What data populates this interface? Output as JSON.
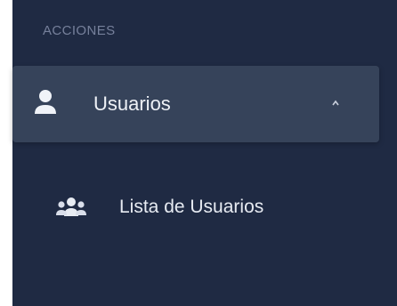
{
  "sidebar": {
    "section_title": "ACCIONES",
    "menu": {
      "label": "Usuarios",
      "icon": "user-icon",
      "expanded": true,
      "chevron_icon": "chevron-up-icon",
      "submenu": [
        {
          "label": "Lista de Usuarios",
          "icon": "users-group-icon"
        }
      ]
    }
  },
  "colors": {
    "sidebar_background": "#1f2a43",
    "active_item_background": "#36435a",
    "primary_text": "#eef1f6",
    "muted_text": "#76809b",
    "icon": "#e8ecf3"
  }
}
